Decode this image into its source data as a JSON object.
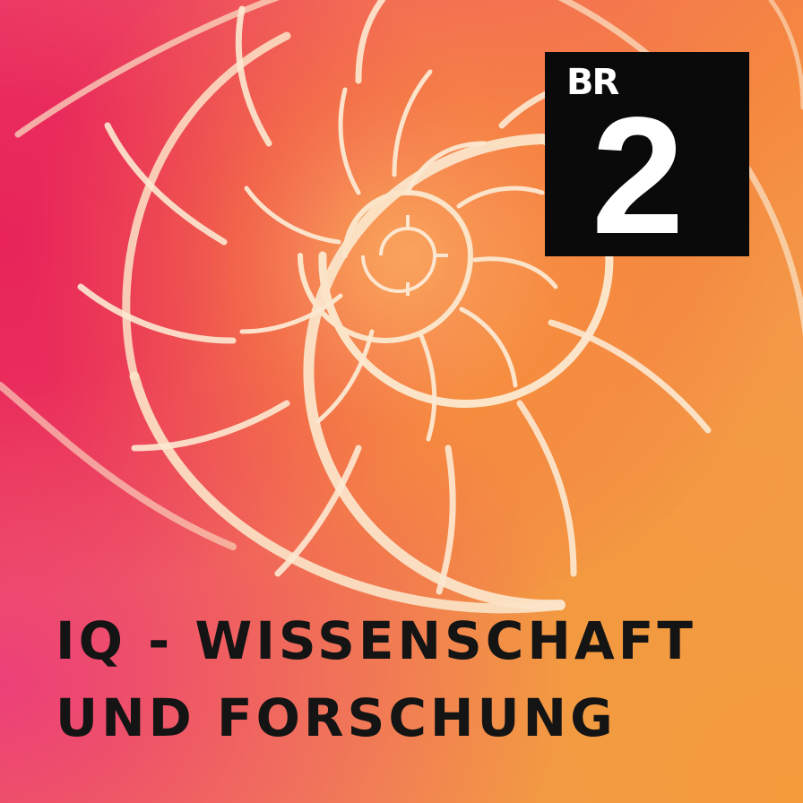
{
  "logo": {
    "brand": "BR",
    "number": "2"
  },
  "title": {
    "line1": "IQ - WISSENSCHAFT",
    "line2": "UND FORSCHUNG"
  },
  "colors": {
    "pink": "#e8245a",
    "orange": "#f58a3f",
    "shell_rib": "#fbe2c4",
    "logo_bg": "#0a0a0a",
    "title_text": "#141414"
  }
}
